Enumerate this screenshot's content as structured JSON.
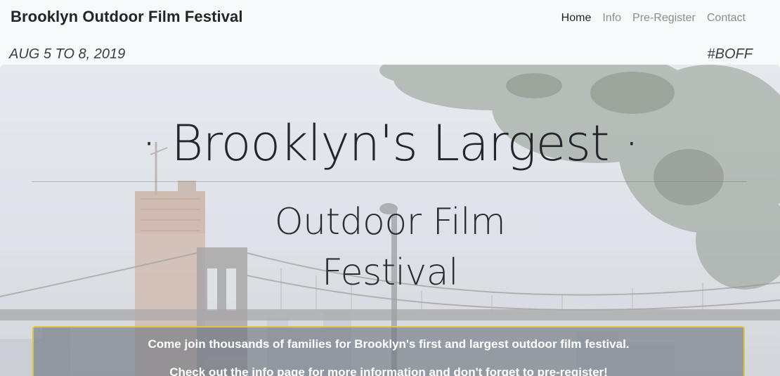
{
  "navbar": {
    "brand": "Brooklyn Outdoor Film Festival",
    "links": [
      {
        "label": "Home",
        "active": true
      },
      {
        "label": "Info",
        "active": false
      },
      {
        "label": "Pre-Register",
        "active": false
      },
      {
        "label": "Contact",
        "active": false
      }
    ],
    "date_line": "AUG 5 TO 8, 2019",
    "hashtag": "#BOFF"
  },
  "hero": {
    "title": "· Brooklyn's Largest ·",
    "subtitle_line1": "Outdoor Film",
    "subtitle_line2": "Festival",
    "info_line1": "Come join thousands of families for Brooklyn's first and largest outdoor film festival.",
    "info_line2": "Check out the info page for more information and don't forget to pre-register!"
  },
  "colors": {
    "navbar_bg": "#f8f9fa",
    "text_dark": "#212529",
    "nav_muted": "#8a8d91",
    "info_border": "#e3c24a"
  }
}
